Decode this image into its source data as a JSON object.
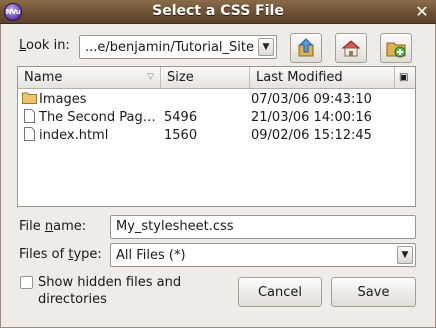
{
  "window": {
    "title": "Select a CSS File",
    "icon_text": "NVu"
  },
  "look_in": {
    "label_pre": "",
    "label_mn": "L",
    "label_post": "ook in:",
    "value": "...e/benjamin/Tutorial_Site"
  },
  "toolbar": {
    "up": "go-up-icon",
    "home": "home-icon",
    "new_folder": "new-folder-icon"
  },
  "file_list": {
    "columns": [
      "Name",
      "Size",
      "Last Modified"
    ],
    "rows": [
      {
        "name": "Images",
        "size": "",
        "modified": "07/03/06 09:43:10",
        "icon": "folder-icon"
      },
      {
        "name": "The Second Pag…",
        "size": "5496",
        "modified": "21/03/06 14:00:16",
        "icon": "file-icon"
      },
      {
        "name": "index.html",
        "size": "1560",
        "modified": "09/02/06 15:12:45",
        "icon": "file-icon"
      }
    ]
  },
  "file_name": {
    "label_pre": "File ",
    "label_mn": "n",
    "label_post": "ame:",
    "value": "My_stylesheet.css"
  },
  "file_type": {
    "label_pre": "Files of ",
    "label_mn": "t",
    "label_post": "ype:",
    "value": "All Files (*)"
  },
  "show_hidden": {
    "line1": "Show hidden files and",
    "line2": "directories",
    "checked": false
  },
  "buttons": {
    "cancel": "Cancel",
    "save": "Save"
  }
}
